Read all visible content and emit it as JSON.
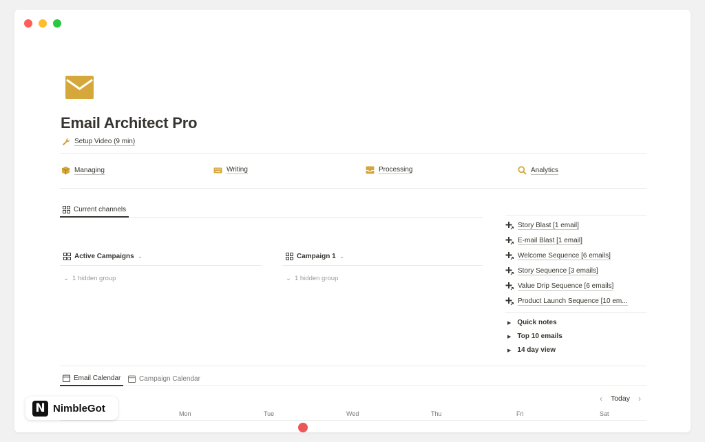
{
  "window": {
    "controls": [
      "close",
      "minimize",
      "zoom"
    ]
  },
  "page": {
    "icon": "envelope-icon",
    "icon_color": "#d6a83c",
    "title": "Email Architect Pro",
    "setup_link": {
      "icon": "wrench-icon",
      "label": "Setup Video (9 min)"
    }
  },
  "nav": [
    {
      "icon": "box-icon",
      "label": "Managing"
    },
    {
      "icon": "keyboard-icon",
      "label": "Writing"
    },
    {
      "icon": "inbox-icon",
      "label": "Processing"
    },
    {
      "icon": "magnifier-icon",
      "label": "Analytics"
    }
  ],
  "channels_tab": {
    "label": "Current channels"
  },
  "boards": [
    {
      "title": "Active Campaigns",
      "hidden": "1 hidden group"
    },
    {
      "title": "Campaign 1",
      "hidden": "1 hidden group"
    }
  ],
  "sequences": [
    "Story Blast [1 email]",
    "E-mail Blast [1 email]",
    "Welcome Sequence [6 emails]",
    "Story Sequence [3 emails]",
    "Value Drip Sequence [6 emails]",
    "Product Launch Sequence [10 em..."
  ],
  "toggles": [
    "Quick notes",
    "Top 10 emails",
    "14 day view"
  ],
  "calendar": {
    "tabs": [
      "Email Calendar",
      "Campaign Calendar"
    ],
    "today_label": "Today",
    "days": [
      "Mon",
      "Tue",
      "Wed",
      "Thu",
      "Fri",
      "Sat"
    ]
  },
  "badge": {
    "logo_letter": "N",
    "text": "NimbleGot"
  }
}
